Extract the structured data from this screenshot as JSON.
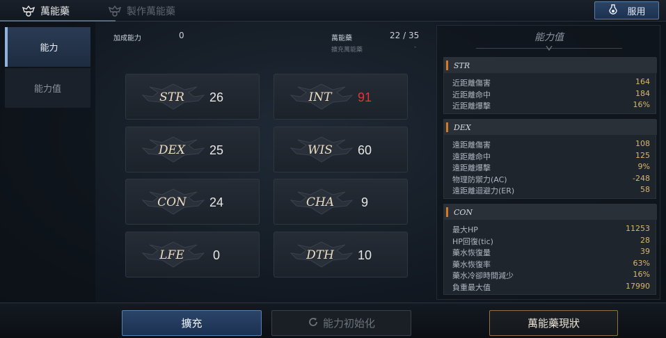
{
  "tabs": {
    "active": {
      "label": "萬能藥",
      "icon": "elixir-crest-icon"
    },
    "inactive": {
      "label": "製作萬能藥",
      "icon": "craft-crest-icon"
    }
  },
  "use_button": {
    "label": "服用",
    "icon": "potion-icon"
  },
  "sidebar": {
    "items": [
      {
        "label": "能力"
      },
      {
        "label": "能力值"
      }
    ]
  },
  "header": {
    "bonus_label": "加成能力",
    "bonus_value": "0",
    "elixir_label": "萬能藥",
    "elixir_value": "22 / 35",
    "expand_label": "擴充萬能藥",
    "expand_value": "-"
  },
  "stats": [
    {
      "label": "STR",
      "value": "26",
      "color": "#e6e6e6"
    },
    {
      "label": "INT",
      "value": "91",
      "color": "#e53434"
    },
    {
      "label": "DEX",
      "value": "25",
      "color": "#e6e6e6"
    },
    {
      "label": "WIS",
      "value": "60",
      "color": "#e6e6e6"
    },
    {
      "label": "CON",
      "value": "24",
      "color": "#e6e6e6"
    },
    {
      "label": "CHA",
      "value": "9",
      "color": "#e6e6e6"
    },
    {
      "label": "LFE",
      "value": "0",
      "color": "#e6e6e6"
    },
    {
      "label": "DTH",
      "value": "10",
      "color": "#e6e6e6"
    }
  ],
  "panel": {
    "title": "能力值",
    "sections": [
      {
        "name": "STR",
        "rows": [
          {
            "label": "近距離傷害",
            "value": "164"
          },
          {
            "label": "近距離命中",
            "value": "184"
          },
          {
            "label": "近距離爆擊",
            "value": "16%"
          }
        ]
      },
      {
        "name": "DEX",
        "rows": [
          {
            "label": "遠距離傷害",
            "value": "108"
          },
          {
            "label": "遠距離命中",
            "value": "125"
          },
          {
            "label": "遠距離爆擊",
            "value": "9%"
          },
          {
            "label": "物理防禦力(AC)",
            "value": "-248"
          },
          {
            "label": "遠距離迴避力(ER)",
            "value": "58"
          }
        ]
      },
      {
        "name": "CON",
        "rows": [
          {
            "label": "最大HP",
            "value": "11253"
          },
          {
            "label": "HP回復(tic)",
            "value": "28"
          },
          {
            "label": "藥水恢復量",
            "value": "39"
          },
          {
            "label": "藥水恢復率",
            "value": "63%"
          },
          {
            "label": "藥水冷卻時間減少",
            "value": "16%"
          },
          {
            "label": "負重最大值",
            "value": "17990"
          }
        ]
      }
    ]
  },
  "bottom": {
    "expand_button": "擴充",
    "reset_button": "能力初始化",
    "reset_icon": "refresh-icon",
    "status_button": "萬能藥現狀"
  },
  "colors": {
    "accent_blue": "#2a4468",
    "highlight_red": "#e53434",
    "value_gold": "#d9b76b",
    "section_orange": "#d07a2a"
  }
}
